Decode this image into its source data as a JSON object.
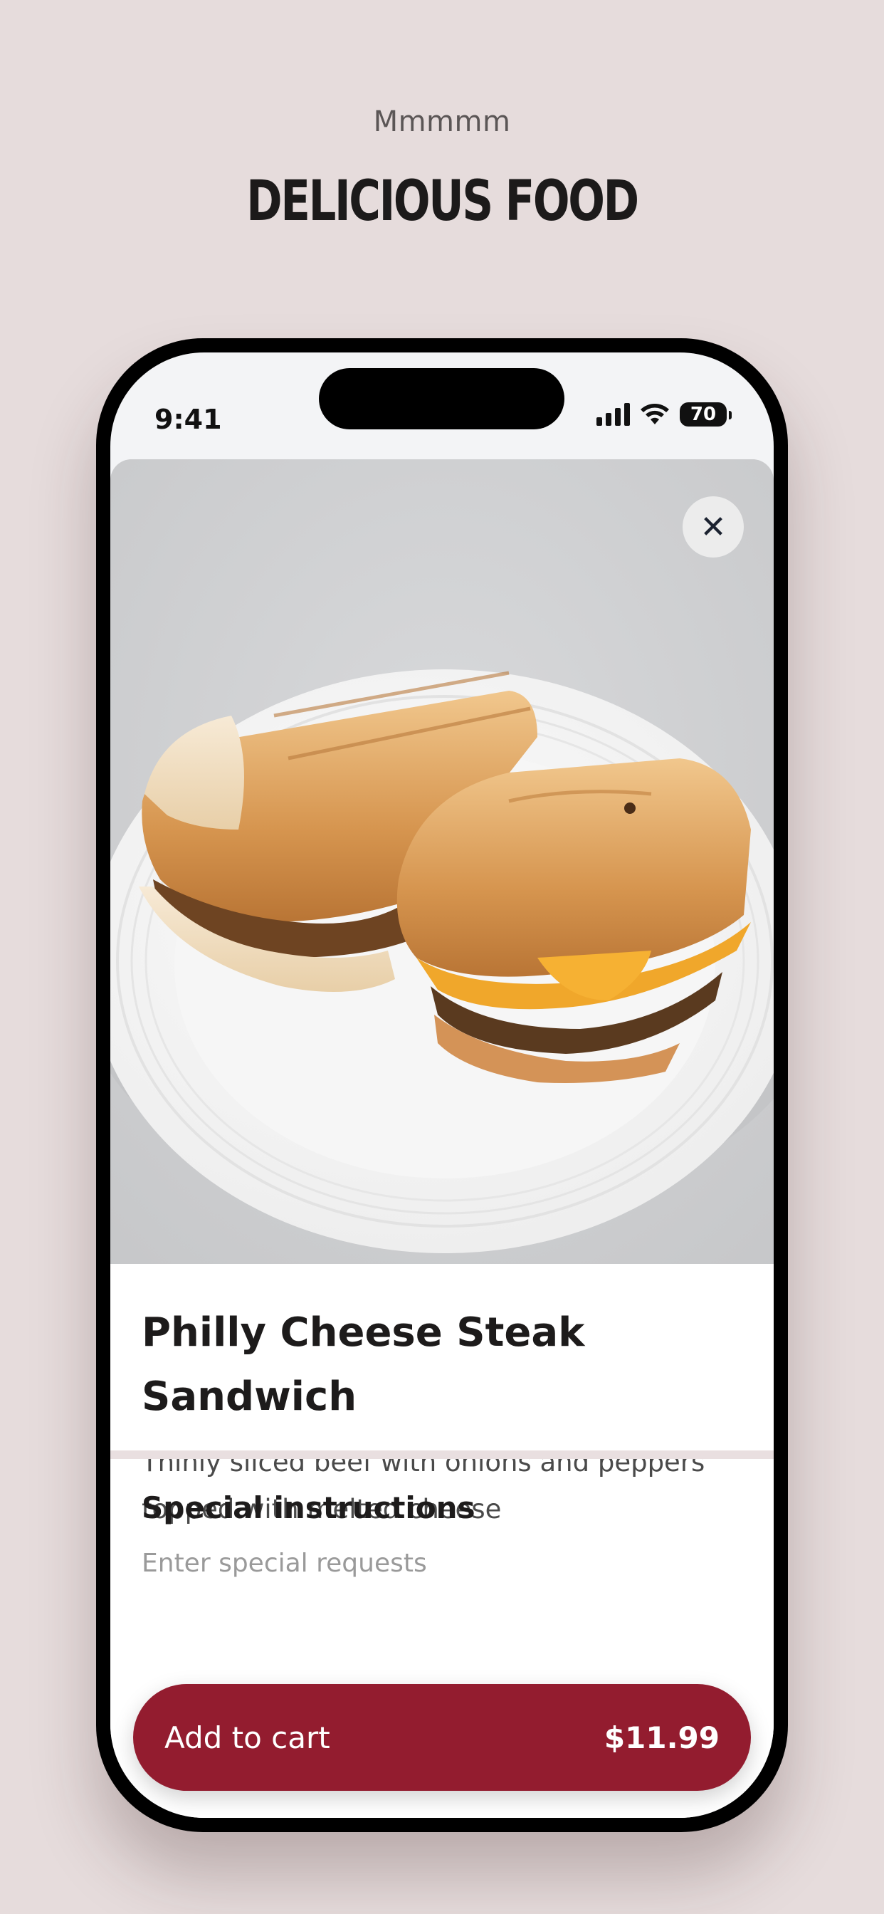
{
  "header": {
    "eyebrow": "Mmmmm",
    "headline": "Delicious Food"
  },
  "status_bar": {
    "time": "9:41",
    "battery": "70"
  },
  "product": {
    "title": "Philly Cheese Steak Sandwich",
    "description": "Thinly sliced beef with onions and peppers topped with melted cheese",
    "image_icon": "sandwich-photo"
  },
  "instructions": {
    "heading": "Special instructions",
    "placeholder": "Enter special requests"
  },
  "cart": {
    "label": "Add to cart",
    "price": "$11.99"
  },
  "colors": {
    "background": "#e6dcdc",
    "accent": "#931c2f"
  }
}
